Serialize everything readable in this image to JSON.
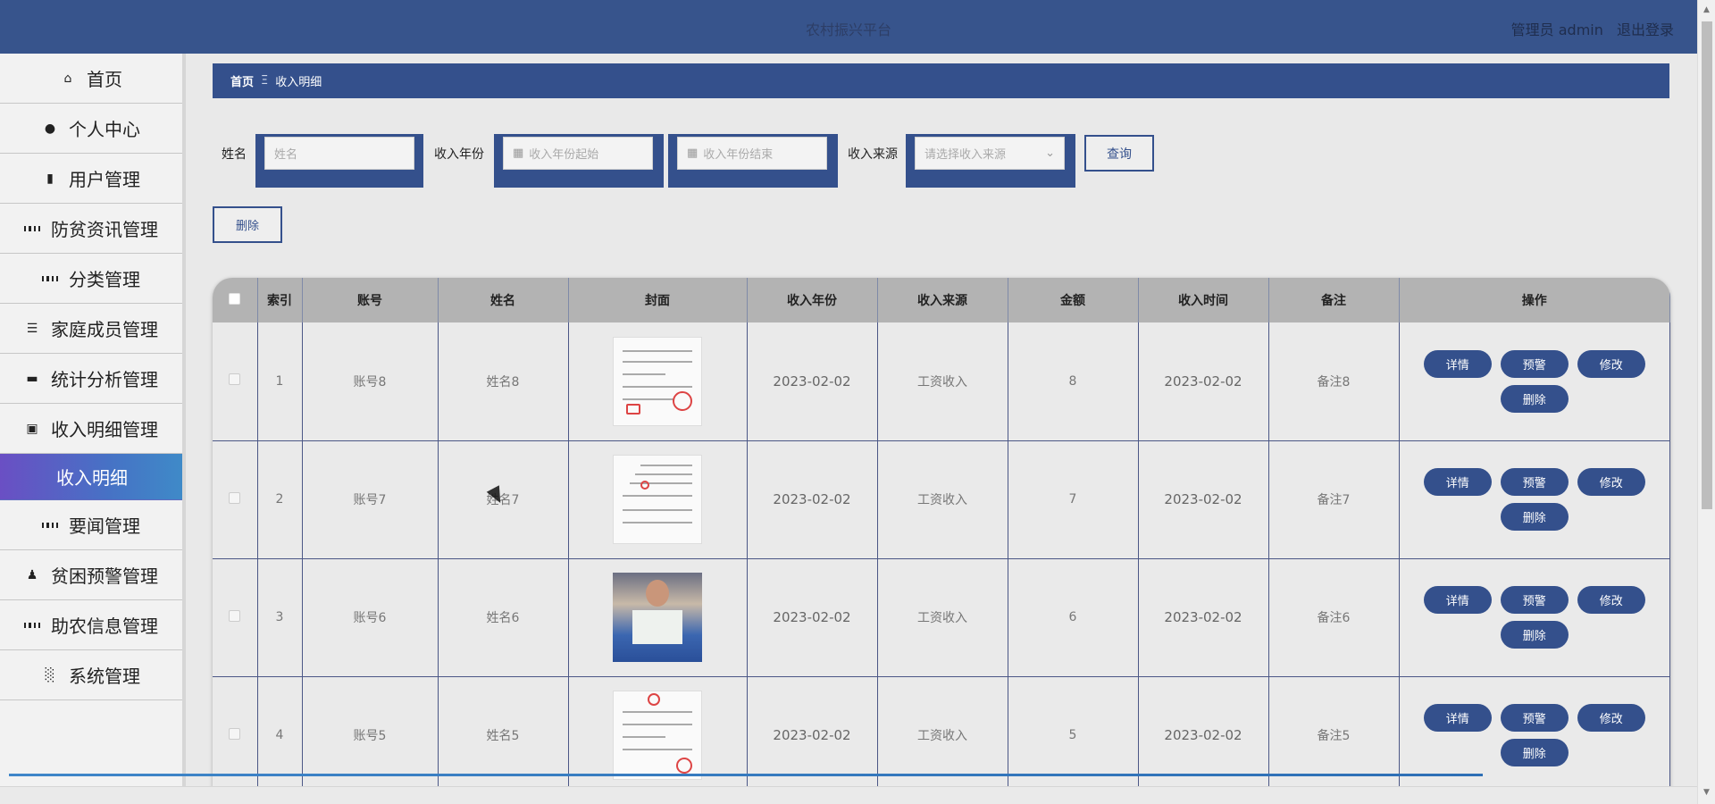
{
  "header": {
    "title": "农村振兴平台",
    "role": "管理员 admin",
    "logout": "退出登录"
  },
  "sidebar": {
    "items": [
      {
        "label": "首页",
        "icon": "home-icon"
      },
      {
        "label": "个人中心",
        "icon": "user-icon"
      },
      {
        "label": "用户管理",
        "icon": "users-icon"
      },
      {
        "label": "防贫资讯管理",
        "icon": "grid-icon"
      },
      {
        "label": "分类管理",
        "icon": "grid-icon"
      },
      {
        "label": "家庭成员管理",
        "icon": "list-icon"
      },
      {
        "label": "统计分析管理",
        "icon": "ticket-icon"
      },
      {
        "label": "收入明细管理",
        "icon": "chart-icon"
      },
      {
        "label": "收入明细",
        "icon": ""
      },
      {
        "label": "要闻管理",
        "icon": "grid-icon"
      },
      {
        "label": "贫困预警管理",
        "icon": "person-icon"
      },
      {
        "label": "助农信息管理",
        "icon": "grid-icon"
      },
      {
        "label": "系统管理",
        "icon": "bar-chart-icon"
      }
    ]
  },
  "breadcrumb": {
    "home": "首页",
    "separator": "Ξ",
    "current": "收入明细"
  },
  "search": {
    "name_label": "姓名",
    "name_placeholder": "姓名",
    "year_label": "收入年份",
    "year_start_placeholder": "收入年份起始",
    "year_end_placeholder": "收入年份结束",
    "source_label": "收入来源",
    "source_placeholder": "请选择收入来源",
    "query_button": "查询"
  },
  "actions": {
    "delete_button": "删除"
  },
  "table": {
    "columns": [
      "索引",
      "账号",
      "姓名",
      "封面",
      "收入年份",
      "收入来源",
      "金额",
      "收入时间",
      "备注",
      "操作"
    ],
    "rows": [
      {
        "index": "1",
        "account": "账号8",
        "name": "姓名8",
        "year": "2023-02-02",
        "source": "工资收入",
        "amount": "8",
        "time": "2023-02-02",
        "remark": "备注8"
      },
      {
        "index": "2",
        "account": "账号7",
        "name": "姓名7",
        "year": "2023-02-02",
        "source": "工资收入",
        "amount": "7",
        "time": "2023-02-02",
        "remark": "备注7"
      },
      {
        "index": "3",
        "account": "账号6",
        "name": "姓名6",
        "year": "2023-02-02",
        "source": "工资收入",
        "amount": "6",
        "time": "2023-02-02",
        "remark": "备注6"
      },
      {
        "index": "4",
        "account": "账号5",
        "name": "姓名5",
        "year": "2023-02-02",
        "source": "工资收入",
        "amount": "5",
        "time": "2023-02-02",
        "remark": "备注5"
      }
    ],
    "row_actions": {
      "detail": "详情",
      "warn": "预警",
      "edit": "修改",
      "delete": "删除"
    }
  },
  "colors": {
    "primary": "#34508c",
    "active_gradient_start": "#6a4fc4",
    "active_gradient_end": "#3f8ac8"
  }
}
